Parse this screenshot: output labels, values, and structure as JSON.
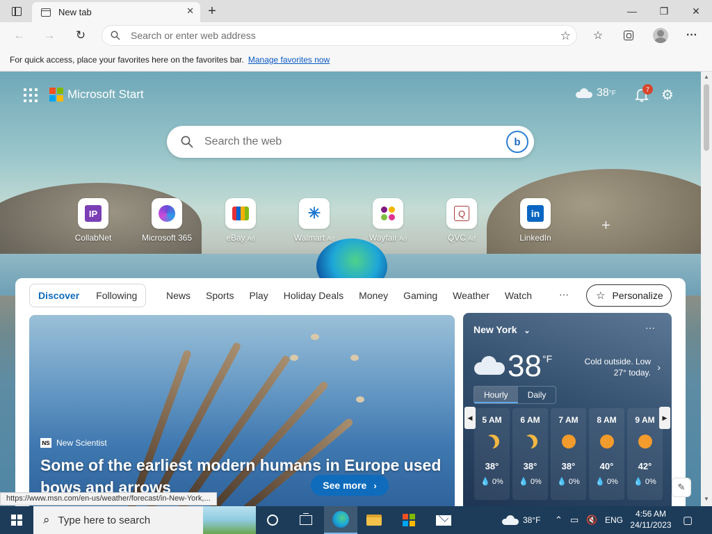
{
  "browser": {
    "tab_title": "New tab",
    "tab_close": "✕",
    "new_tab": "+",
    "minimize": "—",
    "restore": "❐",
    "close": "✕",
    "back": "←",
    "forward": "→",
    "refresh": "↻",
    "address_placeholder": "Search or enter web address",
    "favorites_hint": "For quick access, place your favorites here on the favorites bar.",
    "manage_favorites": "Manage favorites now",
    "status_url": "https://www.msn.com/en-us/weather/forecast/in-New-York,..."
  },
  "page": {
    "brand": "Microsoft Start",
    "header_temp": "38",
    "header_unit": "°F",
    "notification_count": "7",
    "search_placeholder": "Search the web",
    "quick_links": [
      {
        "label": "CollabNet",
        "ad": ""
      },
      {
        "label": "Microsoft 365",
        "ad": ""
      },
      {
        "label": "eBay",
        "ad": "Ad"
      },
      {
        "label": "Walmart",
        "ad": "Ad"
      },
      {
        "label": "Wayfair",
        "ad": "Ad"
      },
      {
        "label": "QVC",
        "ad": "Ad"
      },
      {
        "label": "LinkedIn",
        "ad": ""
      }
    ],
    "pivots": [
      "Discover",
      "Following"
    ],
    "nav": [
      "News",
      "Sports",
      "Play",
      "Holiday Deals",
      "Money",
      "Gaming",
      "Weather",
      "Watch"
    ],
    "more": "···",
    "personalize": "Personalize",
    "article": {
      "source_logo": "NS",
      "source": "New Scientist",
      "headline": "Some of the earliest modern humans in Europe used bows and arrows",
      "see_more": "See more"
    },
    "weather": {
      "city": "New York",
      "temp": "38",
      "unit": "°F",
      "description": "Cold outside. Low 27° today.",
      "tab_hourly": "Hourly",
      "tab_daily": "Daily",
      "hours": [
        {
          "time": "5 AM",
          "icon": "moon",
          "temp": "38°",
          "precip": "0%"
        },
        {
          "time": "6 AM",
          "icon": "moon",
          "temp": "38°",
          "precip": "0%"
        },
        {
          "time": "7 AM",
          "icon": "sun",
          "temp": "38°",
          "precip": "0%"
        },
        {
          "time": "8 AM",
          "icon": "sun",
          "temp": "40°",
          "precip": "0%"
        },
        {
          "time": "9 AM",
          "icon": "sun",
          "temp": "42°",
          "precip": "0%"
        }
      ]
    }
  },
  "taskbar": {
    "search_placeholder": "Type here to search",
    "weather": "38°F",
    "language": "ENG",
    "time": "4:56 AM",
    "date": "24/11/2023"
  },
  "colors": {
    "accent": "#0f6cbd",
    "taskbar": "#1d3c5a",
    "badge": "#d7462d"
  }
}
